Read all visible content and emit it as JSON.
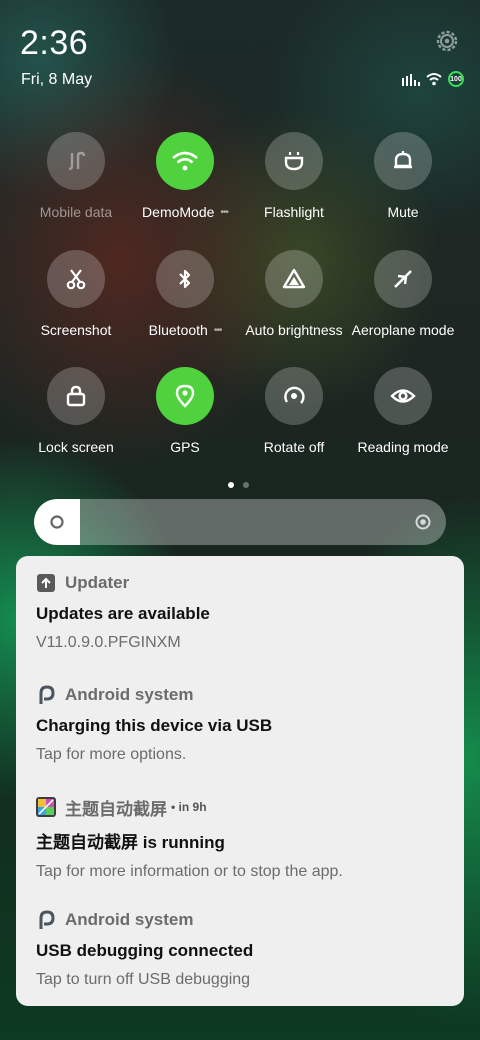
{
  "status_bar": {
    "time": "2:36",
    "date": "Fri, 8 May",
    "battery_level": "100",
    "icons": [
      "signal-icon",
      "wifi-icon",
      "battery-icon"
    ]
  },
  "quick_settings": {
    "tiles": [
      {
        "label": "Mobile data",
        "icon": "mobile-data-icon",
        "state": "disabled"
      },
      {
        "label": "DemoMode",
        "icon": "wifi-icon",
        "state": "on",
        "more": "•••"
      },
      {
        "label": "Flashlight",
        "icon": "flashlight-icon",
        "state": "off"
      },
      {
        "label": "Mute",
        "icon": "bell-icon",
        "state": "off"
      },
      {
        "label": "Screenshot",
        "icon": "scissors-icon",
        "state": "off"
      },
      {
        "label": "Bluetooth",
        "icon": "bluetooth-icon",
        "state": "off",
        "more": "•••"
      },
      {
        "label": "Auto brightness",
        "icon": "auto-brightness-icon",
        "state": "off"
      },
      {
        "label": "Aeroplane mode",
        "icon": "airplane-icon",
        "state": "off"
      },
      {
        "label": "Lock screen",
        "icon": "lock-icon",
        "state": "off"
      },
      {
        "label": "GPS",
        "icon": "location-icon",
        "state": "on"
      },
      {
        "label": "Rotate off",
        "icon": "rotate-icon",
        "state": "off"
      },
      {
        "label": "Reading mode",
        "icon": "eye-icon",
        "state": "off"
      }
    ],
    "page_count": 2,
    "active_page": 1
  },
  "brightness": {
    "level": 0.0
  },
  "colors": {
    "active_tile": "#4fd23d",
    "battery_ring": "#36e05a",
    "panel": "#efefef"
  },
  "notifications": [
    {
      "app": "Updater",
      "icon": "upload-arrow-icon",
      "meta": "",
      "title": "Updates are available",
      "text": "V11.0.9.0.PFGINXM"
    },
    {
      "app": "Android system",
      "icon": "android-p-icon",
      "meta": "",
      "title": "Charging this device via USB",
      "text": "Tap for more options."
    },
    {
      "app": "主题自动截屏",
      "icon": "screenshot-app-icon",
      "meta": "• in 9h",
      "title": "主题自动截屏 is running",
      "text": "Tap for more information or to stop the app."
    },
    {
      "app": "Android system",
      "icon": "android-p-icon",
      "meta": "",
      "title": "USB debugging connected",
      "text": "Tap to turn off USB debugging"
    }
  ]
}
